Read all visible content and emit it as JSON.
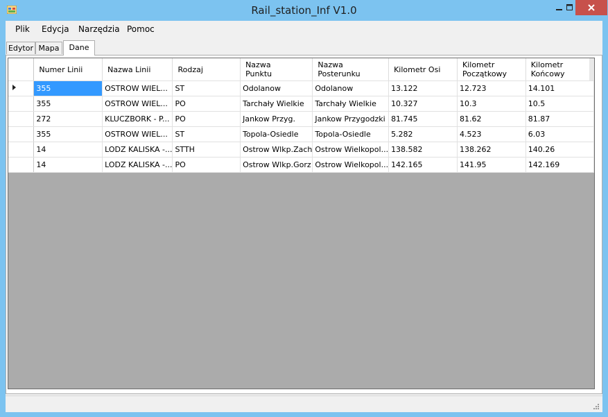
{
  "window": {
    "title": "Rail_station_Inf V1.0"
  },
  "menu": {
    "items": [
      "Plik",
      "Edycja",
      "Narzędzia",
      "Pomoc"
    ]
  },
  "tabs": [
    {
      "label": "Edytor",
      "active": false
    },
    {
      "label": "Mapa",
      "active": false
    },
    {
      "label": "Dane",
      "active": true
    }
  ],
  "table": {
    "columns": [
      {
        "line1": "Numer Linii",
        "line2": ""
      },
      {
        "line1": "Nazwa Linii",
        "line2": ""
      },
      {
        "line1": "Rodzaj",
        "line2": ""
      },
      {
        "line1": "Nazwa",
        "line2": "Punktu"
      },
      {
        "line1": "Nazwa",
        "line2": "Posterunku"
      },
      {
        "line1": "Kilometr Osi",
        "line2": ""
      },
      {
        "line1": "Kilometr",
        "line2": "Początkowy"
      },
      {
        "line1": "Kilometr",
        "line2": "Końcowy"
      }
    ],
    "rows": [
      [
        "355",
        "OSTROW WIEL...",
        "ST",
        "Odolanow",
        "Odolanow",
        "13.122",
        "12.723",
        "14.101"
      ],
      [
        "355",
        "OSTROW WIEL...",
        "PO",
        "Tarchały Wielkie",
        "Tarchały Wielkie",
        "10.327",
        "10.3",
        "10.5"
      ],
      [
        "272",
        "KLUCZBORK - P...",
        "PO",
        "Jankow Przyg.",
        "Jankow Przygodzki",
        "81.745",
        "81.62",
        "81.87"
      ],
      [
        "355",
        "OSTROW WIEL...",
        "ST",
        "Topola-Osiedle",
        "Topola-Osiedle",
        "5.282",
        "4.523",
        "6.03"
      ],
      [
        "14",
        "LODZ KALISKA -...",
        "STTH",
        "Ostrow Wlkp.Zach",
        "Ostrow Wielkopol...",
        "138.582",
        "138.262",
        "140.26"
      ],
      [
        "14",
        "LODZ KALISKA -...",
        "PO",
        "Ostrow Wlkp.Gorz",
        "Ostrow Wielkopol...",
        "142.165",
        "141.95",
        "142.169"
      ]
    ],
    "selected_row": 0
  },
  "colors": {
    "titlebar": "#7cc3f0",
    "close": "#c7514b",
    "selection": "#3399ff",
    "grid_bg": "#ababab"
  }
}
